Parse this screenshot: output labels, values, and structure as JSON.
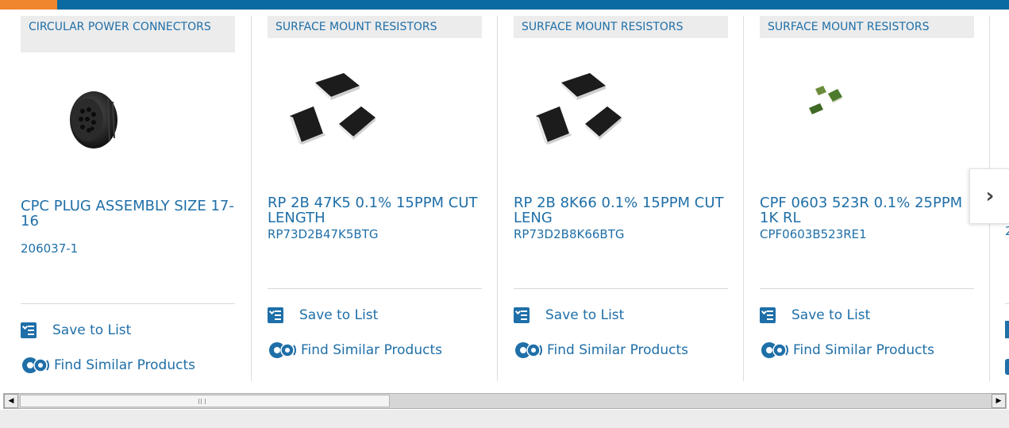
{
  "products": [
    {
      "category": "CIRCULAR POWER CONNECTORS",
      "title": "CPC PLUG ASSEMBLY SIZE 17-16",
      "part_number": "206037-1",
      "image": "circular-connector"
    },
    {
      "category": "SURFACE MOUNT RESISTORS",
      "title": "RP 2B 47K5 0.1% 15PPM CUT LENGTH",
      "part_number": "RP73D2B47K5BTG",
      "image": "smd-resistors-black"
    },
    {
      "category": "SURFACE MOUNT RESISTORS",
      "title": "RP 2B 8K66 0.1% 15PPM CUT LENG",
      "part_number": "RP73D2B8K66BTG",
      "image": "smd-resistors-black"
    },
    {
      "category": "SURFACE MOUNT RESISTORS",
      "title": "CPF 0603 523R 0.1% 25PPM 1K RL",
      "part_number": "CPF0603B523RE1",
      "image": "smd-resistors-green"
    }
  ],
  "actions": {
    "save_label": "Save to List",
    "similar_label": "Find Similar Products"
  },
  "peek": {
    "part_number_start": "2"
  },
  "icons": {
    "save": "list-check-icon",
    "similar": "gears-icon",
    "next": "chevron-right-icon"
  },
  "colors": {
    "link": "#1f6fa8",
    "top_bar": "#0a6aa1",
    "top_accent": "#f0862e",
    "category_bg": "#ececec"
  }
}
